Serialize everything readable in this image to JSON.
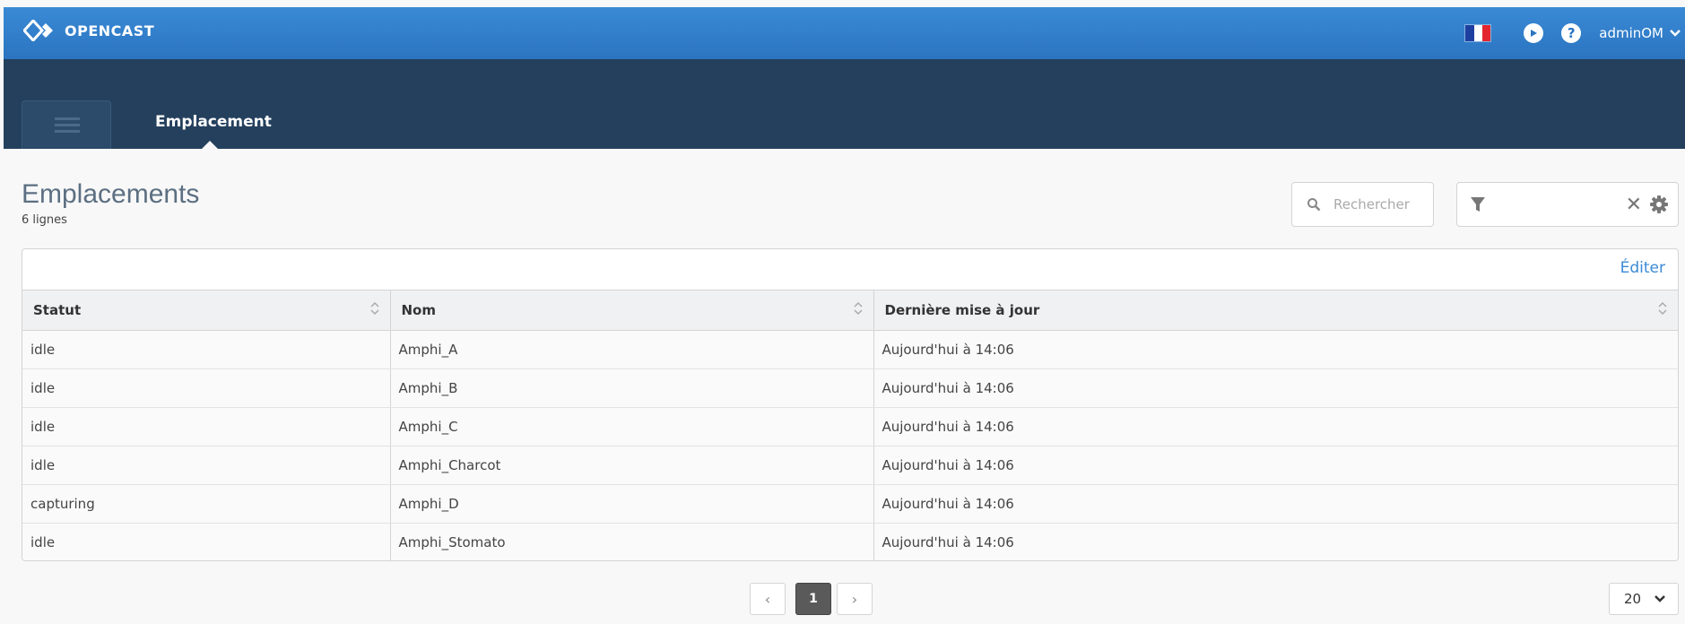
{
  "header": {
    "brand": "OPENCAST",
    "language_flag": "france-flag",
    "user": "adminOM"
  },
  "nav": {
    "active_tab": "Emplacement"
  },
  "page": {
    "title": "Emplacements",
    "subtitle": "6 lignes"
  },
  "search": {
    "placeholder": "Rechercher"
  },
  "table": {
    "edit_label": "Éditer",
    "columns": [
      "Statut",
      "Nom",
      "Dernière mise à jour"
    ],
    "rows": [
      {
        "status": "idle",
        "name": "Amphi_A",
        "updated": "Aujourd'hui à 14:06"
      },
      {
        "status": "idle",
        "name": "Amphi_B",
        "updated": "Aujourd'hui à 14:06"
      },
      {
        "status": "idle",
        "name": "Amphi_C",
        "updated": "Aujourd'hui à 14:06"
      },
      {
        "status": "idle",
        "name": "Amphi_Charcot",
        "updated": "Aujourd'hui à 14:06"
      },
      {
        "status": "capturing",
        "name": "Amphi_D",
        "updated": "Aujourd'hui à 14:06"
      },
      {
        "status": "idle",
        "name": "Amphi_Stomato",
        "updated": "Aujourd'hui à 14:06"
      }
    ]
  },
  "pagination": {
    "prev": "‹",
    "current_page": "1",
    "next": "›",
    "page_size": "20"
  },
  "colors": {
    "topbar": "#2b74c0",
    "navbar": "#24405d",
    "accent": "#3a8ad6"
  }
}
